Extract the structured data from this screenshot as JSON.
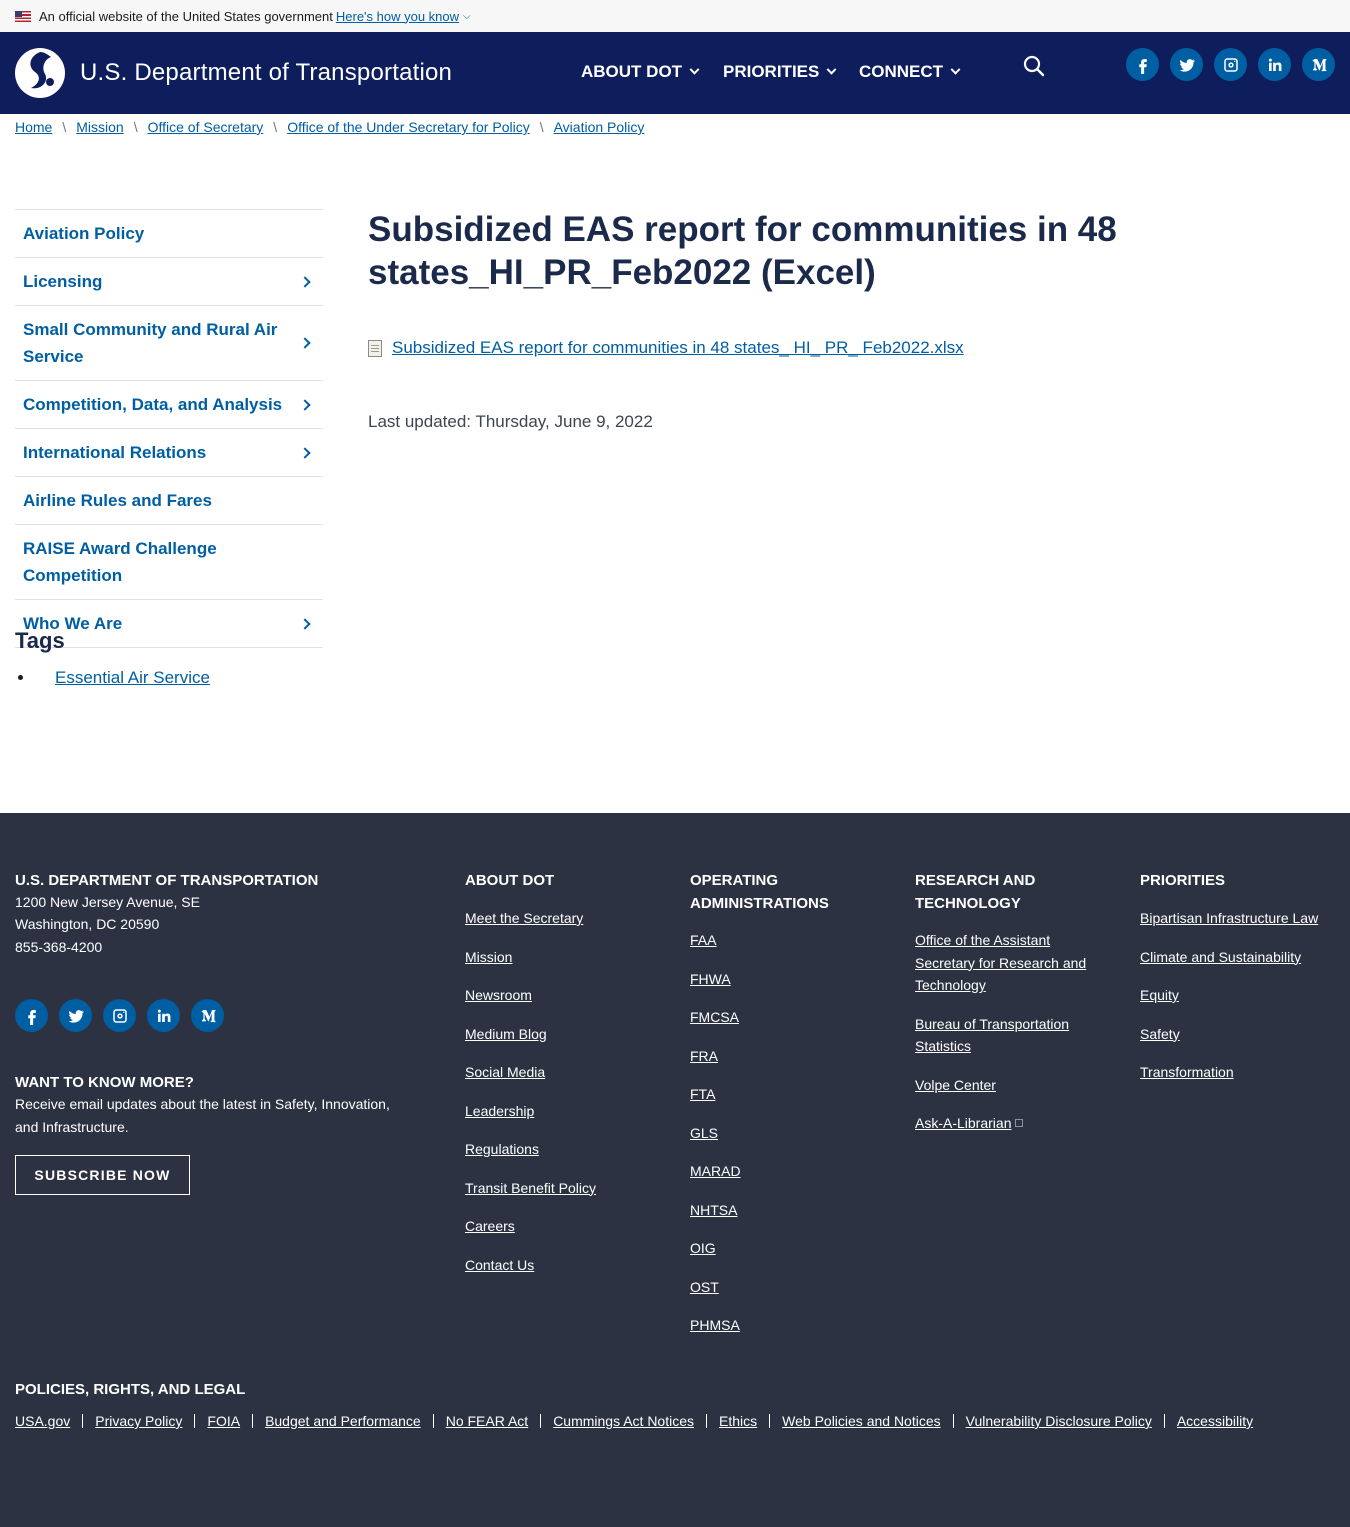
{
  "gov_banner": {
    "text": "An official website of the United States government",
    "link": "Here's how you know"
  },
  "header": {
    "site_title": "U.S. Department of Transportation",
    "nav": [
      "ABOUT DOT",
      "PRIORITIES",
      "CONNECT"
    ],
    "social": [
      "facebook-icon",
      "twitter-icon",
      "instagram-icon",
      "linkedin-icon",
      "medium-icon"
    ]
  },
  "breadcrumb": [
    "Home",
    "Mission",
    "Office of Secretary",
    "Office of the Under Secretary for Policy",
    "Aviation Policy"
  ],
  "sidenav": [
    {
      "label": "Aviation Policy",
      "has_children": false
    },
    {
      "label": "Licensing",
      "has_children": true
    },
    {
      "label": "Small Community and Rural Air Service",
      "has_children": true
    },
    {
      "label": "Competition, Data, and Analysis",
      "has_children": true
    },
    {
      "label": "International Relations",
      "has_children": true
    },
    {
      "label": "Airline Rules and Fares",
      "has_children": false
    },
    {
      "label": "RAISE Award Challenge Competition",
      "has_children": false
    },
    {
      "label": "Who We Are",
      "has_children": true
    }
  ],
  "tags": {
    "title": "Tags",
    "items": [
      "Essential Air Service"
    ]
  },
  "main": {
    "title": "Subsidized EAS report for communities in 48 states_HI_PR_Feb2022 (Excel)",
    "file_link": "Subsidized EAS report for communities in 48 states_ HI_ PR_ Feb2022.xlsx",
    "last_updated": "Last updated: Thursday, June 9, 2022"
  },
  "footer": {
    "org_heading": "U.S. DEPARTMENT OF TRANSPORTATION",
    "address1": "1200 New Jersey Avenue, SE",
    "address2": "Washington, DC 20590",
    "phone": "855-368-4200",
    "want_heading": "WANT TO KNOW MORE?",
    "want_text": "Receive email updates about the latest in Safety, Innovation, and Infrastructure.",
    "subscribe": "SUBSCRIBE NOW",
    "columns": [
      {
        "heading": "ABOUT DOT",
        "links": [
          "Meet the Secretary",
          "Mission",
          "Newsroom",
          "Medium Blog",
          "Social Media",
          "Leadership",
          "Regulations",
          "Transit Benefit Policy",
          "Careers",
          "Contact Us"
        ]
      },
      {
        "heading": "OPERATING ADMINISTRATIONS",
        "links": [
          "FAA",
          "FHWA",
          "FMCSA",
          "FRA",
          "FTA",
          "GLS",
          "MARAD",
          "NHTSA",
          "OIG",
          "OST",
          "PHMSA"
        ]
      },
      {
        "heading": "RESEARCH AND TECHNOLOGY",
        "links": [
          "Office of the Assistant Secretary for Research and Technology",
          "Bureau of Transportation Statistics",
          "Volpe Center",
          "Ask-A-Librarian"
        ]
      },
      {
        "heading": "PRIORITIES",
        "links": [
          "Bipartisan Infrastructure Law",
          "Climate and Sustainability",
          "Equity",
          "Safety",
          "Transformation"
        ]
      }
    ],
    "legal_heading": "POLICIES, RIGHTS, AND LEGAL",
    "legal_links": [
      "USA.gov",
      "Privacy Policy",
      "FOIA",
      "Budget and Performance",
      "No FEAR Act",
      "Cummings Act Notices",
      "Ethics",
      "Web Policies and Notices",
      "Vulnerability Disclosure Policy",
      "Accessibility"
    ]
  },
  "colors": {
    "header_bg": "#0e1e5c",
    "footer_bg": "#2c3241",
    "link": "#005ea2",
    "title": "#1b2a4a"
  }
}
